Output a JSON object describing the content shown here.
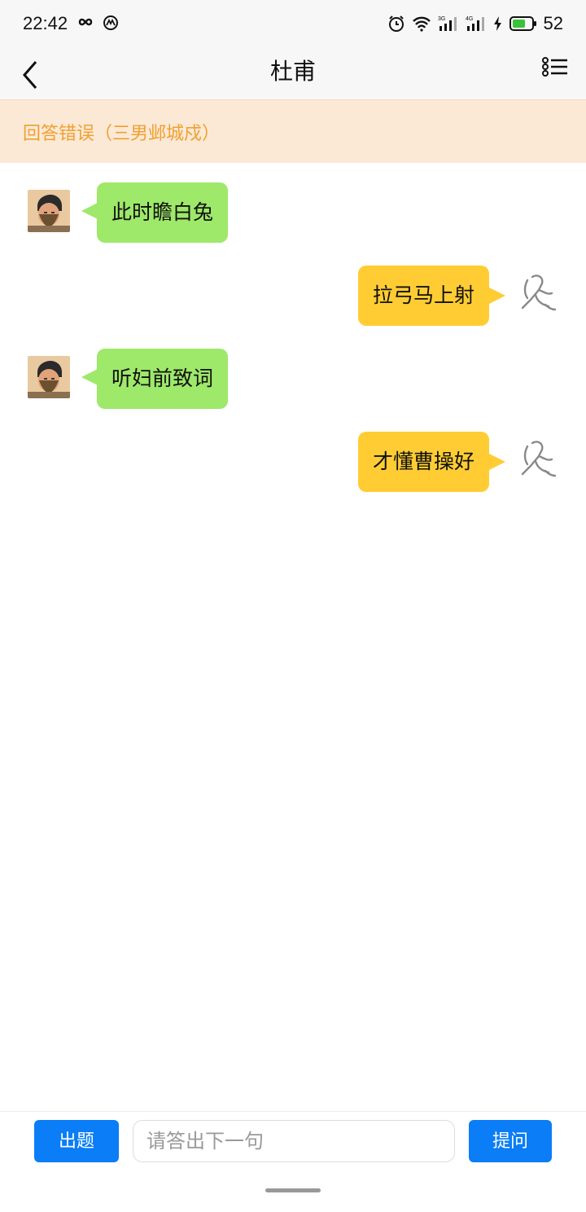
{
  "status_bar": {
    "time": "22:42",
    "battery": "52",
    "icons": [
      "infinity-icon",
      "notification-icon",
      "alarm-icon",
      "wifi-icon",
      "signal-3g-icon",
      "signal-4g-icon",
      "charging-icon",
      "battery-icon"
    ]
  },
  "nav": {
    "title": "杜甫",
    "back_icon": "chevron-left-icon",
    "menu_icon": "list-icon"
  },
  "banner": {
    "text": "回答错误（三男邺城戍）",
    "color": "#f0a030",
    "background": "#fbe9d6"
  },
  "chat": {
    "messages": [
      {
        "side": "left",
        "text": "此时瞻白兔"
      },
      {
        "side": "right",
        "text": "拉弓马上射"
      },
      {
        "side": "left",
        "text": "听妇前致词"
      },
      {
        "side": "right",
        "text": "才懂曹操好"
      }
    ],
    "left_bubble_color": "#9ee86a",
    "right_bubble_color": "#ffcd33"
  },
  "bottom": {
    "question_button": "出题",
    "input_placeholder": "请答出下一句",
    "ask_button": "提问",
    "button_color": "#0a7df7"
  }
}
